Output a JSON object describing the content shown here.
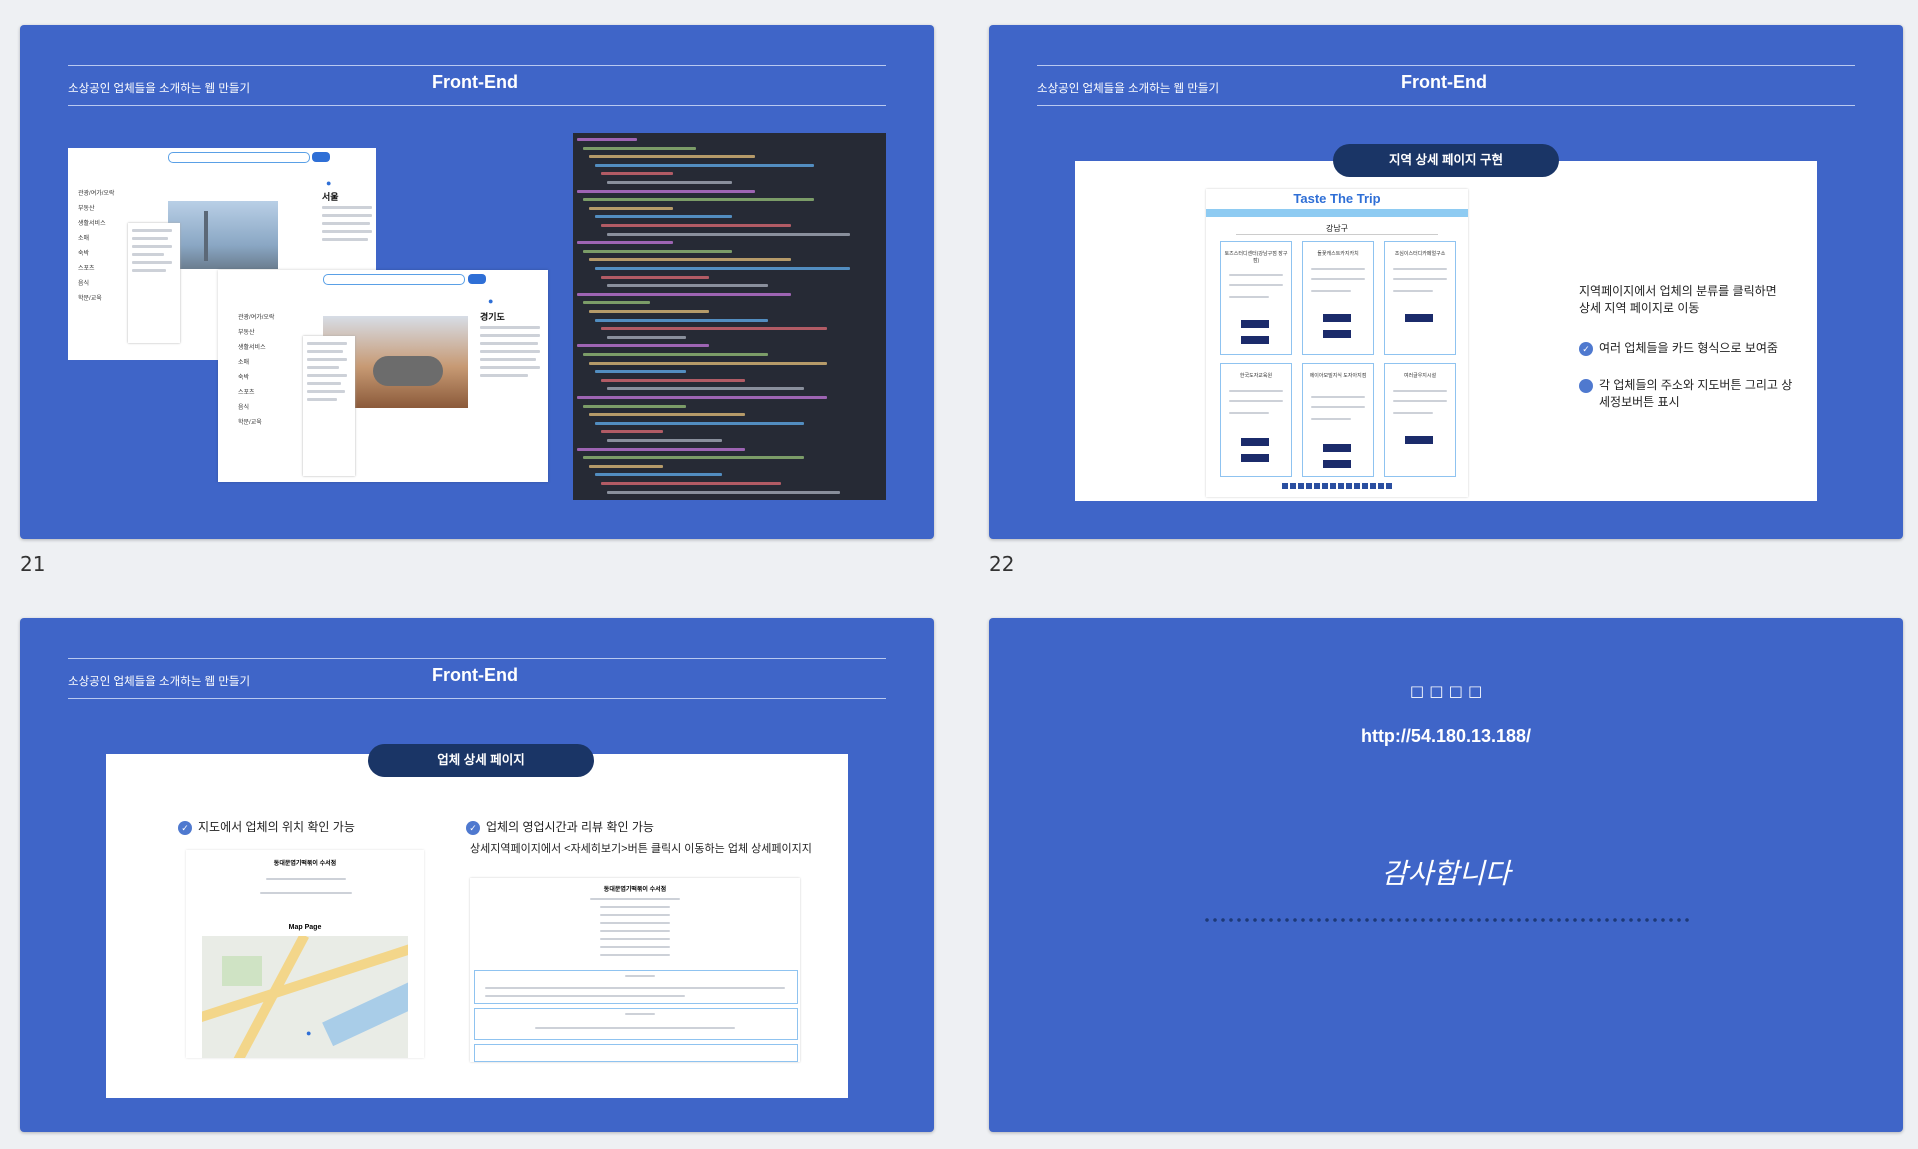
{
  "slides": [
    {
      "number": "21",
      "header": {
        "subtitle": "소상공인 업체들을 소개하는 웹 만들기",
        "title": "Front-End"
      },
      "mock_seoul": {
        "title": "서울",
        "menu": [
          "관광/여가/오락",
          "부동산",
          "생활서비스",
          "소매",
          "숙박",
          "스포츠",
          "음식",
          "학문/교육"
        ]
      },
      "mock_gyeonggi": {
        "title": "경기도",
        "menu": [
          "관광/여가/오락",
          "부동산",
          "생활서비스",
          "소매",
          "숙박",
          "스포츠",
          "음식",
          "학문/교육"
        ]
      }
    },
    {
      "number": "22",
      "header": {
        "subtitle": "소상공인 업체들을 소개하는 웹 만들기",
        "title": "Front-End"
      },
      "pill": "지역 상세 페이지 구현",
      "mock": {
        "brand": "Taste The Trip",
        "district": "강남구",
        "cards": [
          "토즈스터디센터(강남구점 장구점)",
          "돌꽃캐스트카지카치",
          "조심이스터디카페얼구소",
          "한국도자교육원",
          "에이아모빌지식 도자아지점",
          "여러글우지시설"
        ]
      },
      "desc": "지역페이지에서 업체의 분류를 클릭하면 상세 지역 페이지로 이동",
      "bullets": [
        "여러 업체들을 카드 형식으로 보여줌",
        "각 업체들의 주소와 지도버튼 그리고 상세정보버튼 표시"
      ]
    },
    {
      "header": {
        "subtitle": "소상공인 업체들을 소개하는 웹 만들기",
        "title": "Front-End"
      },
      "pill": "업체 상세 페이지",
      "left": {
        "bullet": "지도에서 업체의 위치 확인 가능",
        "mock_title": "동대문엽기떡볶이 수서점",
        "map_label": "Map Page"
      },
      "right": {
        "bullet": "업체의 영업시간과 리뷰 확인 가능",
        "desc": "상세지역페이지에서 <자세히보기>버튼 클릭시 이동하는 업체 상세페이지지",
        "mock_title": "동대문엽기떡볶이 수서점"
      }
    },
    {
      "boxes": "□ □ □ □",
      "url": "http://54.180.13.188/",
      "thanks": "감사합니다"
    }
  ]
}
